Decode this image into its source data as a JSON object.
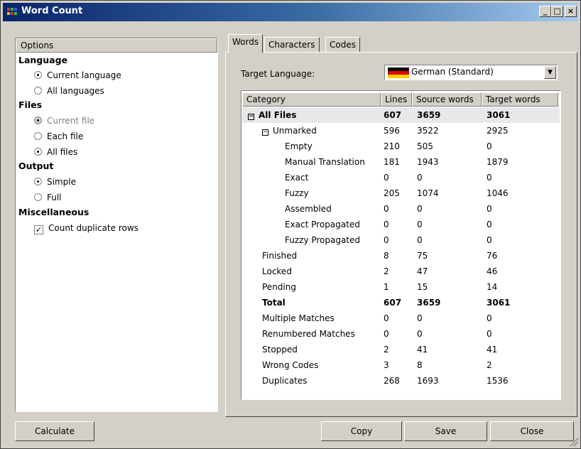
{
  "window": {
    "title": "Word Count",
    "controls": [
      "_",
      "□",
      "×"
    ]
  },
  "options": {
    "header": "Options",
    "sections": [
      {
        "title": "Language",
        "items": [
          {
            "label": "Current language",
            "type": "radio",
            "checked": true,
            "disabled": false
          },
          {
            "label": "All languages",
            "type": "radio",
            "checked": false,
            "disabled": false
          }
        ]
      },
      {
        "title": "Files",
        "items": [
          {
            "label": "Current file",
            "type": "radio",
            "checked": true,
            "disabled": true
          },
          {
            "label": "Each file",
            "type": "radio",
            "checked": false,
            "disabled": false
          },
          {
            "label": "All files",
            "type": "radio",
            "checked": true,
            "disabled": false
          }
        ]
      },
      {
        "title": "Output",
        "items": [
          {
            "label": "Simple",
            "type": "radio",
            "checked": true,
            "disabled": false
          },
          {
            "label": "Full",
            "type": "radio",
            "checked": false,
            "disabled": false
          }
        ]
      },
      {
        "title": "Miscellaneous",
        "items": [
          {
            "label": "Count duplicate rows",
            "type": "checkbox",
            "checked": true,
            "disabled": false
          }
        ]
      }
    ]
  },
  "tabs": [
    "Words",
    "Characters",
    "Codes"
  ],
  "target_language": {
    "label": "Target Language:",
    "value": "German (Standard)"
  },
  "table": {
    "columns": [
      "Category",
      "Lines",
      "Source words",
      "Target words"
    ],
    "rows": [
      {
        "category": "All Files",
        "lines": "607",
        "source": "3659",
        "target": "3061",
        "level": 0,
        "bold": true,
        "expander": "−",
        "selected": true
      },
      {
        "category": "Unmarked",
        "lines": "596",
        "source": "3522",
        "target": "2925",
        "level": 1,
        "bold": false,
        "expander": "−"
      },
      {
        "category": "Empty",
        "lines": "210",
        "source": "505",
        "target": "0",
        "level": 2,
        "bold": false
      },
      {
        "category": "Manual Translation",
        "lines": "181",
        "source": "1943",
        "target": "1879",
        "level": 2,
        "bold": false
      },
      {
        "category": "Exact",
        "lines": "0",
        "source": "0",
        "target": "0",
        "level": 2,
        "bold": false
      },
      {
        "category": "Fuzzy",
        "lines": "205",
        "source": "1074",
        "target": "1046",
        "level": 2,
        "bold": false
      },
      {
        "category": "Assembled",
        "lines": "0",
        "source": "0",
        "target": "0",
        "level": 2,
        "bold": false
      },
      {
        "category": "Exact Propagated",
        "lines": "0",
        "source": "0",
        "target": "0",
        "level": 2,
        "bold": false
      },
      {
        "category": "Fuzzy Propagated",
        "lines": "0",
        "source": "0",
        "target": "0",
        "level": 2,
        "bold": false
      },
      {
        "category": "Finished",
        "lines": "8",
        "source": "75",
        "target": "76",
        "level": 1,
        "bold": false
      },
      {
        "category": "Locked",
        "lines": "2",
        "source": "47",
        "target": "46",
        "level": 1,
        "bold": false
      },
      {
        "category": "Pending",
        "lines": "1",
        "source": "15",
        "target": "14",
        "level": 1,
        "bold": false
      },
      {
        "category": "Total",
        "lines": "607",
        "source": "3659",
        "target": "3061",
        "level": 1,
        "bold": true
      },
      {
        "category": "Multiple Matches",
        "lines": "0",
        "source": "0",
        "target": "0",
        "level": 1,
        "bold": false
      },
      {
        "category": "Renumbered Matches",
        "lines": "0",
        "source": "0",
        "target": "0",
        "level": 1,
        "bold": false
      },
      {
        "category": "Stopped",
        "lines": "2",
        "source": "41",
        "target": "41",
        "level": 1,
        "bold": false
      },
      {
        "category": "Wrong Codes",
        "lines": "3",
        "source": "8",
        "target": "2",
        "level": 1,
        "bold": false
      },
      {
        "category": "Duplicates",
        "lines": "268",
        "source": "1693",
        "target": "1536",
        "level": 1,
        "bold": false
      }
    ]
  },
  "buttons": {
    "calculate": "Calculate",
    "copy": "Copy",
    "save": "Save",
    "close": "Close"
  }
}
